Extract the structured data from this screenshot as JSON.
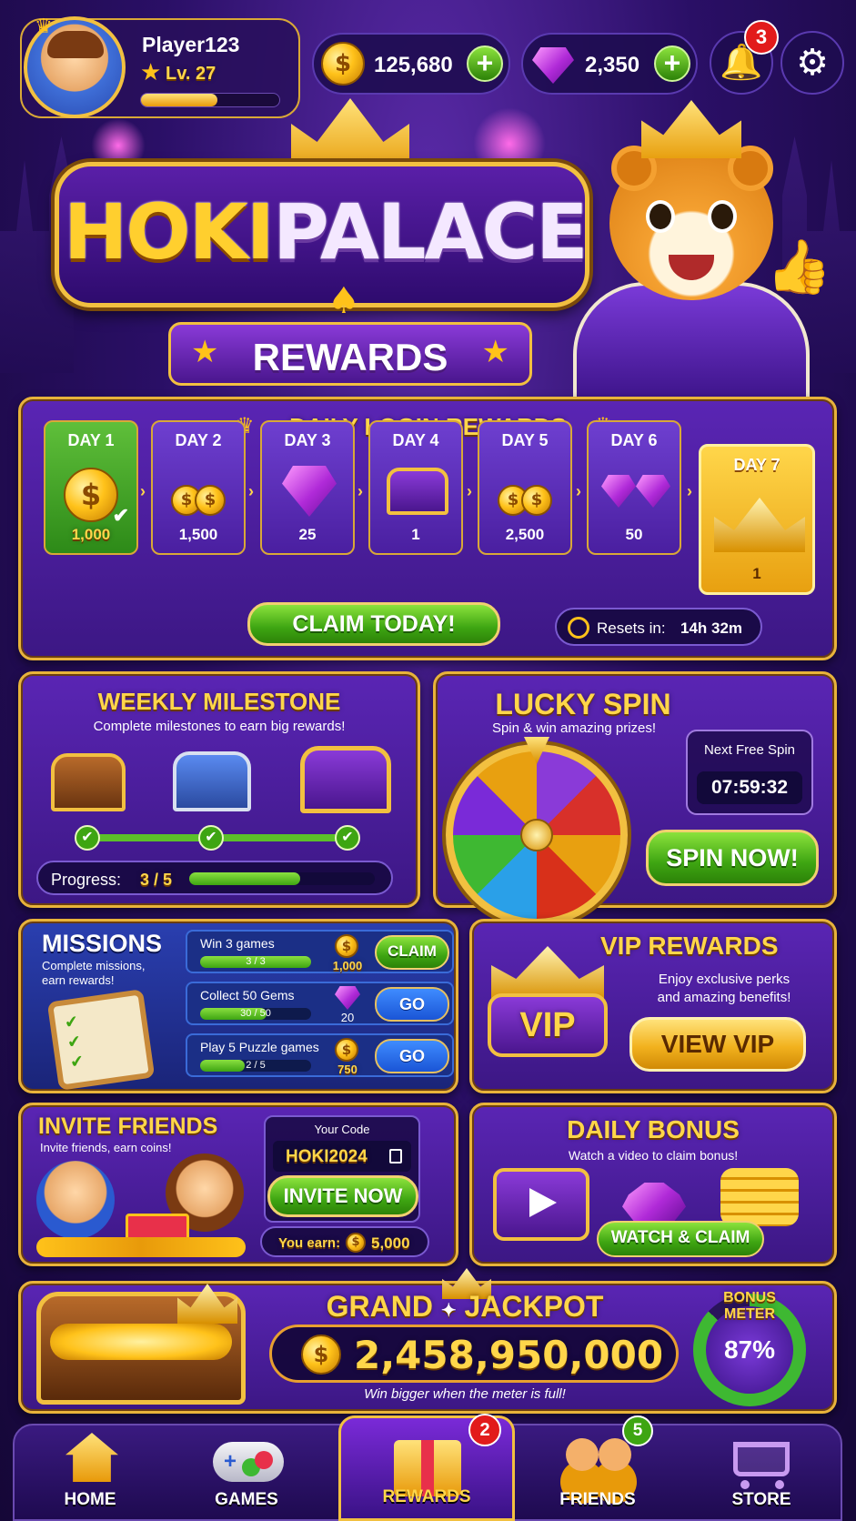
{
  "player": {
    "name": "Player123",
    "level": "Lv. 27",
    "xp_progress": 0.55
  },
  "currency": {
    "coins": "125,680",
    "gems": "2,350"
  },
  "notifications": {
    "count": "3"
  },
  "title": {
    "brand_left": "HOKI",
    "brand_right": "PALACE",
    "subtitle": "REWARDS"
  },
  "daily": {
    "title": "DAILY LOGIN REWARDS",
    "days": [
      {
        "label": "DAY 1",
        "value": "1,000",
        "icon": "coin-icon",
        "claimed": true
      },
      {
        "label": "DAY 2",
        "value": "1,500",
        "icon": "coin-stack-icon",
        "claimed": false
      },
      {
        "label": "DAY 3",
        "value": "25",
        "icon": "gem-icon",
        "claimed": false
      },
      {
        "label": "DAY 4",
        "value": "1",
        "icon": "chest-icon",
        "claimed": false
      },
      {
        "label": "DAY 5",
        "value": "2,500",
        "icon": "coin-stack-icon",
        "claimed": false
      },
      {
        "label": "DAY 6",
        "value": "50",
        "icon": "gem-pile-icon",
        "claimed": false
      },
      {
        "label": "DAY 7",
        "value": "1",
        "icon": "crown-icon",
        "claimed": false
      }
    ],
    "claim_label": "CLAIM TODAY!",
    "resets_label": "Resets in:",
    "resets_value": "14h 32m"
  },
  "weekly": {
    "title": "WEEKLY MILESTONE",
    "subtitle": "Complete milestones to earn big rewards!",
    "progress_label": "Progress:",
    "progress_value": "3 / 5",
    "progress_fraction": 0.6
  },
  "spin": {
    "title": "LUCKY SPIN",
    "subtitle": "Spin & win amazing prizes!",
    "next_label": "Next Free Spin",
    "next_timer": "07:59:32",
    "button": "SPIN NOW!"
  },
  "missions": {
    "title": "MISSIONS",
    "subtitle": "Complete missions, earn rewards!",
    "items": [
      {
        "name": "Win 3 games",
        "progress": "3 / 3",
        "fraction": 1.0,
        "reward": "1,000",
        "reward_icon": "coin-icon",
        "button": "CLAIM"
      },
      {
        "name": "Collect 50 Gems",
        "progress": "30 / 50",
        "fraction": 0.6,
        "reward": "20",
        "reward_icon": "gem-icon",
        "button": "GO"
      },
      {
        "name": "Play 5 Puzzle games",
        "progress": "2 / 5",
        "fraction": 0.4,
        "reward": "750",
        "reward_icon": "coin-icon",
        "button": "GO"
      }
    ]
  },
  "vip": {
    "title": "VIP REWARDS",
    "crown_text": "VIP",
    "subtitle_1": "Enjoy exclusive perks",
    "subtitle_2": "and amazing benefits!",
    "button": "VIEW VIP"
  },
  "invite": {
    "title": "INVITE FRIENDS",
    "subtitle": "Invite friends, earn coins!",
    "code_label": "Your Code",
    "code": "HOKI2024",
    "button": "INVITE NOW",
    "earn_label": "You earn:",
    "earn_value": "5,000"
  },
  "bonus": {
    "title": "DAILY BONUS",
    "subtitle": "Watch a video to claim bonus!",
    "button": "WATCH & CLAIM"
  },
  "jackpot": {
    "title_left": "GRAND",
    "title_right": "JACKPOT",
    "amount": "2,458,950,000",
    "note": "Win bigger when the meter is full!",
    "meter_label_1": "BONUS",
    "meter_label_2": "METER",
    "meter_value": "87%",
    "meter_fraction": 0.87
  },
  "nav": {
    "items": [
      {
        "label": "HOME",
        "icon": "home-icon",
        "badge": ""
      },
      {
        "label": "GAMES",
        "icon": "gamepad-icon",
        "badge": ""
      },
      {
        "label": "REWARDS",
        "icon": "gift-icon",
        "badge": "2"
      },
      {
        "label": "FRIENDS",
        "icon": "friends-icon",
        "badge": "5"
      },
      {
        "label": "STORE",
        "icon": "cart-icon",
        "badge": ""
      }
    ]
  },
  "colors": {
    "gold": "#ffd64a",
    "purple": "#4a1fa0",
    "green": "#3ea512",
    "blue": "#1a55d6",
    "red": "#e21b1b"
  }
}
